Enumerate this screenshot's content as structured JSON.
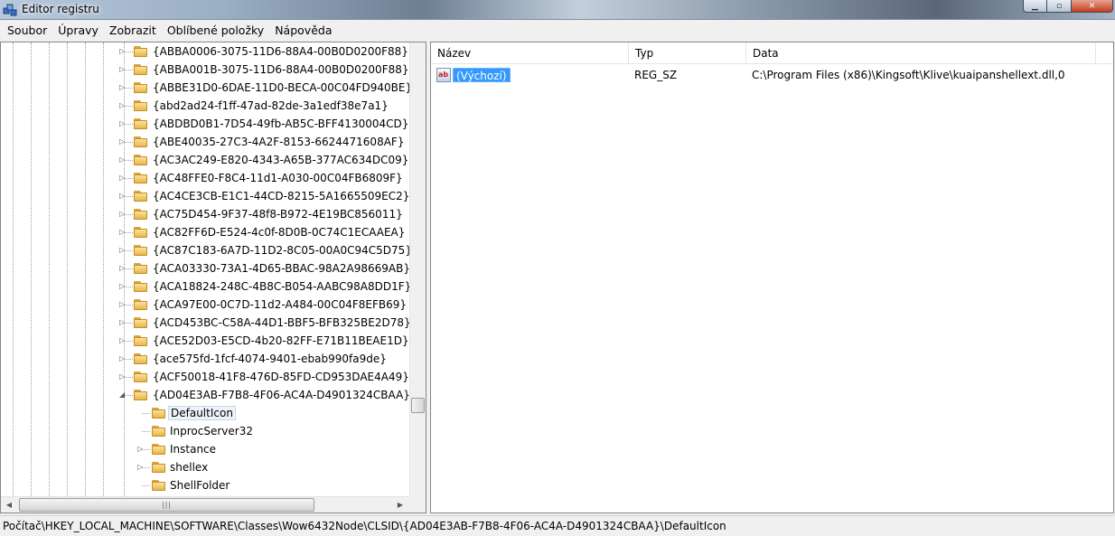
{
  "window": {
    "title": "Editor registru",
    "app_icon": "regedit-icon",
    "controls": {
      "minimize": "minimize-icon",
      "maximize": "maximize-icon",
      "close": "close-icon"
    }
  },
  "menu": [
    "Soubor",
    "Úpravy",
    "Zobrazit",
    "Oblíbené položky",
    "Nápověda"
  ],
  "tree": {
    "nodes": [
      {
        "label": "{ABBA0006-3075-11D6-88A4-00B0D0200F88}",
        "level": 0,
        "expander": "collapsed"
      },
      {
        "label": "{ABBA001B-3075-11D6-88A4-00B0D0200F88}",
        "level": 0,
        "expander": "collapsed"
      },
      {
        "label": "{ABBE31D0-6DAE-11D0-BECA-00C04FD940BE}",
        "level": 0,
        "expander": "collapsed"
      },
      {
        "label": "{abd2ad24-f1ff-47ad-82de-3a1edf38e7a1}",
        "level": 0,
        "expander": "collapsed"
      },
      {
        "label": "{ABDBD0B1-7D54-49fb-AB5C-BFF4130004CD}",
        "level": 0,
        "expander": "collapsed"
      },
      {
        "label": "{ABE40035-27C3-4A2F-8153-6624471608AF}",
        "level": 0,
        "expander": "collapsed"
      },
      {
        "label": "{AC3AC249-E820-4343-A65B-377AC634DC09}",
        "level": 0,
        "expander": "collapsed"
      },
      {
        "label": "{AC48FFE0-F8C4-11d1-A030-00C04FB6809F}",
        "level": 0,
        "expander": "collapsed"
      },
      {
        "label": "{AC4CE3CB-E1C1-44CD-8215-5A1665509EC2}",
        "level": 0,
        "expander": "collapsed"
      },
      {
        "label": "{AC75D454-9F37-48f8-B972-4E19BC856011}",
        "level": 0,
        "expander": "collapsed"
      },
      {
        "label": "{AC82FF6D-E524-4c0f-8D0B-0C74C1ECAAEA}",
        "level": 0,
        "expander": "collapsed"
      },
      {
        "label": "{AC87C183-6A7D-11D2-8C05-00A0C94C5D75}",
        "level": 0,
        "expander": "collapsed"
      },
      {
        "label": "{ACA03330-73A1-4D65-BBAC-98A2A98669AB}",
        "level": 0,
        "expander": "collapsed"
      },
      {
        "label": "{ACA18824-248C-4B8C-B054-AABC98A8DD1F}",
        "level": 0,
        "expander": "collapsed"
      },
      {
        "label": "{ACA97E00-0C7D-11d2-A484-00C04F8EFB69}",
        "level": 0,
        "expander": "collapsed"
      },
      {
        "label": "{ACD453BC-C58A-44D1-BBF5-BFB325BE2D78}",
        "level": 0,
        "expander": "collapsed"
      },
      {
        "label": "{ACE52D03-E5CD-4b20-82FF-E71B11BEAE1D}",
        "level": 0,
        "expander": "collapsed"
      },
      {
        "label": "{ace575fd-1fcf-4074-9401-ebab990fa9de}",
        "level": 0,
        "expander": "collapsed"
      },
      {
        "label": "{ACF50018-41F8-476D-85FD-CD953DAE4A49}",
        "level": 0,
        "expander": "collapsed"
      },
      {
        "label": "{AD04E3AB-F7B8-4F06-AC4A-D4901324CBAA}",
        "level": 0,
        "expander": "expanded"
      },
      {
        "label": "DefaultIcon",
        "level": 1,
        "expander": "none",
        "selected": true
      },
      {
        "label": "InprocServer32",
        "level": 1,
        "expander": "none"
      },
      {
        "label": "Instance",
        "level": 1,
        "expander": "collapsed"
      },
      {
        "label": "shellex",
        "level": 1,
        "expander": "collapsed"
      },
      {
        "label": "ShellFolder",
        "level": 1,
        "expander": "none"
      }
    ],
    "scroll_left_glyph": "◀",
    "scroll_right_glyph": "▶",
    "scroll_thumb_grip": "|||"
  },
  "list": {
    "columns": [
      "Název",
      "Typ",
      "Data"
    ],
    "rows": [
      {
        "name": "(Výchozí)",
        "type": "REG_SZ",
        "data": "C:\\Program Files (x86)\\Kingsoft\\Klive\\kuaipanshellext.dll,0",
        "icon": "string-value-icon",
        "icon_text": "ab"
      }
    ]
  },
  "status": {
    "path": "Počítač\\HKEY_LOCAL_MACHINE\\SOFTWARE\\Classes\\Wow6432Node\\CLSID\\{AD04E3AB-F7B8-4F06-AC4A-D4901324CBAA}\\DefaultIcon"
  },
  "colors": {
    "selection": "#3399ff",
    "folder": "#e8b64b",
    "pane_border": "#828790"
  }
}
